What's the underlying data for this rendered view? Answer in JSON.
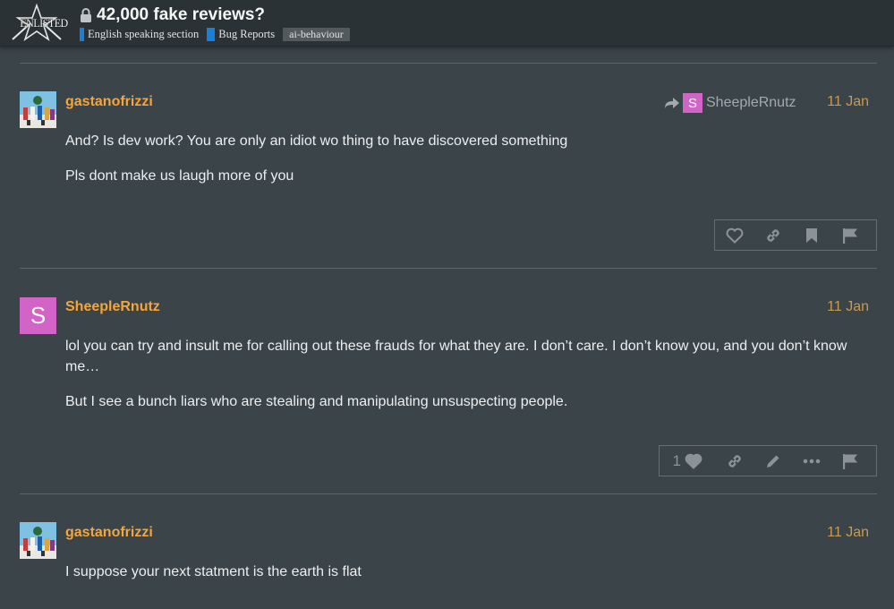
{
  "header": {
    "logo_text": "ENLISTED",
    "topic_title": "42,000 fake reviews?",
    "breadcrumbs": [
      {
        "label": "English speaking section"
      },
      {
        "label": "Bug Reports"
      }
    ],
    "tag": "ai-behaviour"
  },
  "posts": [
    {
      "username": "gastanofrizzi",
      "date": "11 Jan",
      "reply_to": {
        "avatar_letter": "S",
        "username": "SheepleRnutz"
      },
      "paragraphs": [
        "And? Is dev work? You are only an idiot wo thing to have discovered something",
        "Pls dont make us laugh more of you"
      ],
      "actions": [
        "heart-icon",
        "link-icon",
        "bookmark-icon",
        "flag-icon"
      ]
    },
    {
      "username": "SheepleRnutz",
      "avatar_letter": "S",
      "date": "11 Jan",
      "paragraphs": [
        "lol you can try and insult me for calling out these frauds for what they are. I don’t care. I don’t know you, and you don’t know me…",
        "But I see a bunch liars who are stealing and manipulating unsuspecting people."
      ],
      "like_count": "1",
      "actions": [
        "heart-icon",
        "link-icon",
        "edit-icon",
        "more-icon",
        "flag-icon"
      ]
    },
    {
      "username": "gastanofrizzi",
      "date": "11 Jan",
      "paragraphs": [
        "I suppose your next statment is the earth is flat"
      ]
    }
  ],
  "colors": {
    "background": "#3a4449",
    "header": "#2b3236",
    "username": "#f5a53a",
    "date": "#c99a50",
    "category": "#1a7fd9",
    "avatar_pink": "#d264c8"
  }
}
